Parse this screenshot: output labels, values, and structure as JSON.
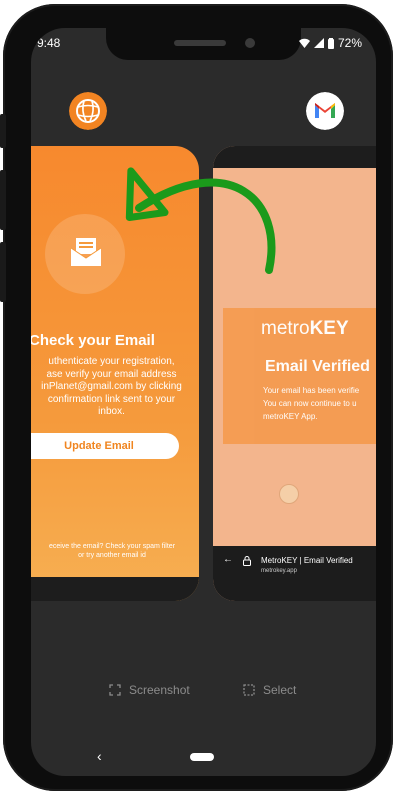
{
  "status_bar": {
    "time": "9:48",
    "battery": "72%"
  },
  "recents": {
    "left_app": {
      "icon": "metrokey-globe-icon",
      "card": {
        "title": "Check your Email",
        "body_lines": [
          "uthenticate your registration,",
          "ase verify your email address",
          "inPlanet@gmail.com by clicking",
          "confirmation link sent to your",
          "inbox."
        ],
        "button_label": "Update Email",
        "footer_lines": [
          "eceive the email? Check your spam filter",
          "or try another email id"
        ]
      }
    },
    "right_app": {
      "icon": "gmail-icon",
      "card": {
        "logo_light": "metro",
        "logo_bold": "KEY",
        "title": "Email Verified",
        "body_lines": [
          "Your email has been verifie",
          "You can now continue to u",
          "metroKEY App."
        ],
        "browser_title": "MetroKEY | Email Verified",
        "browser_url": "metrokey.app"
      }
    }
  },
  "actions": {
    "screenshot_label": "Screenshot",
    "select_label": "Select"
  },
  "colors": {
    "orange": "#f7892e",
    "peach": "#f3b58d",
    "arrow_green": "#1b9a1b"
  }
}
